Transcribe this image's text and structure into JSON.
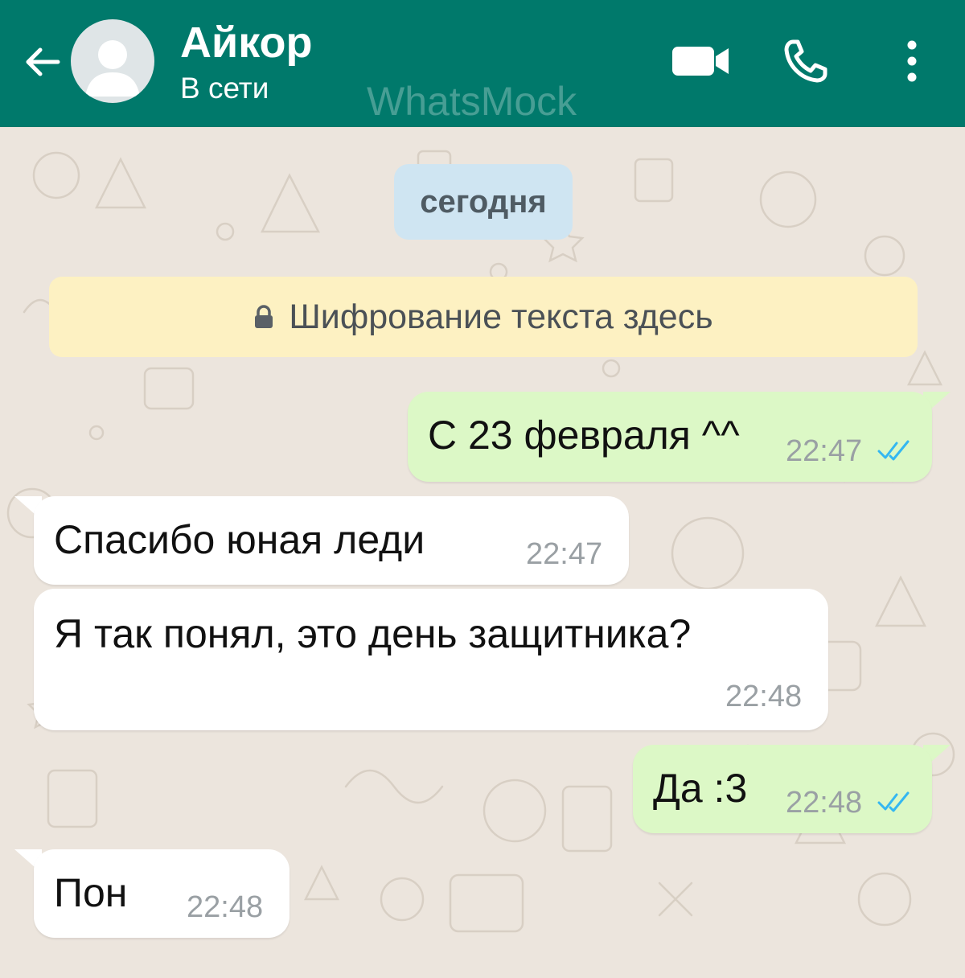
{
  "header": {
    "contact_name": "Айкор",
    "status": "В сети",
    "watermark": "WhatsMock",
    "icons": [
      "back-arrow-icon",
      "avatar-placeholder",
      "video-call-icon",
      "voice-call-icon",
      "more-vert-icon"
    ],
    "colors": {
      "bar": "#00796b",
      "text": "#ffffff"
    }
  },
  "chat": {
    "date_chip": "сегодня",
    "encryption_banner": "Шифрование текста здесь",
    "messages": [
      {
        "direction": "out",
        "text": "С 23 февраля ^^",
        "time": "22:47",
        "status": "read"
      },
      {
        "direction": "in",
        "text": "Спасибо юная леди",
        "time": "22:47"
      },
      {
        "direction": "in",
        "text": "Я так понял, это день защитника?",
        "time": "22:48"
      },
      {
        "direction": "out",
        "text": "Да :3",
        "time": "22:48",
        "status": "read"
      },
      {
        "direction": "in",
        "text": "Пон",
        "time": "22:48"
      }
    ],
    "colors": {
      "outgoing_bubble": "#dcf8c6",
      "incoming_bubble": "#ffffff",
      "read_ticks": "#34b7f1",
      "background": "#ece5dd"
    }
  }
}
